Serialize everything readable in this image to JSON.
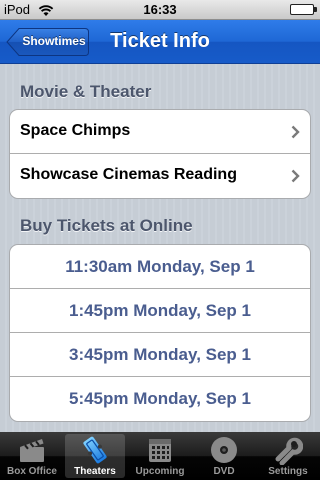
{
  "status_bar": {
    "device": "iPod",
    "time": "16:33"
  },
  "nav": {
    "back_label": "Showtimes",
    "title": "Ticket Info"
  },
  "movie_section": {
    "header": "Movie & Theater",
    "rows": [
      {
        "label": "Space Chimps"
      },
      {
        "label": "Showcase Cinemas Reading"
      }
    ]
  },
  "tickets_section": {
    "header": "Buy Tickets at Online",
    "times": [
      "11:30am Monday, Sep 1",
      "1:45pm Monday, Sep 1",
      "3:45pm Monday, Sep 1",
      "5:45pm Monday, Sep 1"
    ]
  },
  "tab_bar": {
    "tabs": [
      {
        "label": "Box Office",
        "icon": "clapperboard-icon"
      },
      {
        "label": "Theaters",
        "icon": "ticket-icon",
        "active": true
      },
      {
        "label": "Upcoming",
        "icon": "calendar-icon"
      },
      {
        "label": "DVD",
        "icon": "disc-icon"
      },
      {
        "label": "Settings",
        "icon": "wrench-icon"
      }
    ]
  },
  "colors": {
    "nav_blue": "#1e67d5",
    "time_text": "#4a5d8f",
    "section_header": "#4c566c"
  }
}
